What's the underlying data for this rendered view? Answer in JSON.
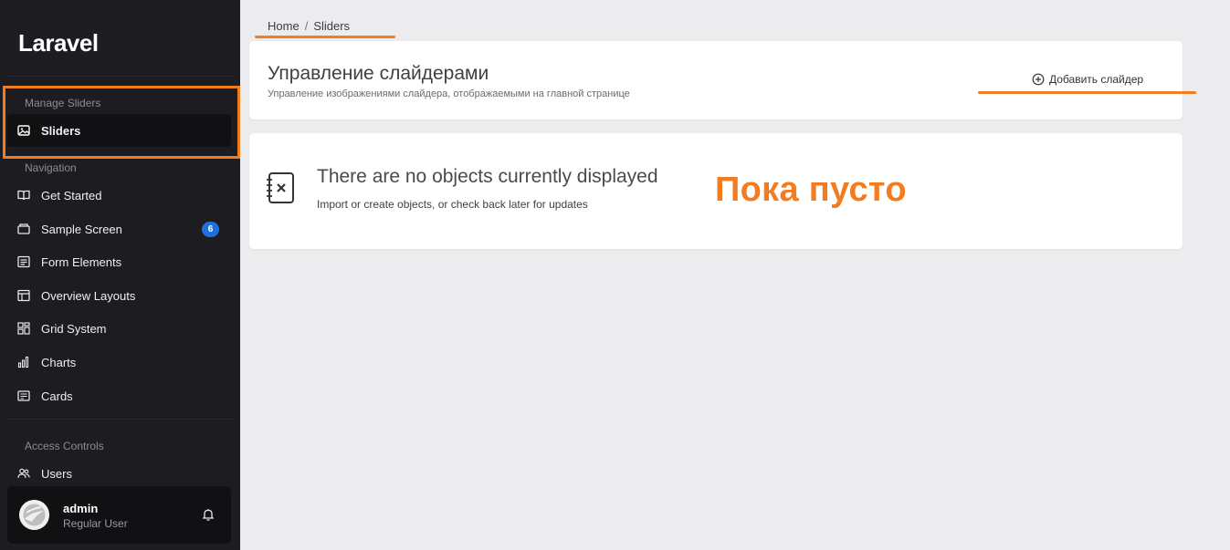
{
  "sidebar": {
    "brand": "Laravel",
    "sections": {
      "manage_sliders": "Manage Sliders",
      "navigation": "Navigation",
      "access_controls": "Access Controls"
    },
    "items": {
      "sliders": {
        "label": "Sliders",
        "icon": "image-icon"
      },
      "get_started": {
        "label": "Get Started",
        "icon": "book-icon"
      },
      "sample_screen": {
        "label": "Sample Screen",
        "icon": "inbox-icon",
        "badge": "6"
      },
      "form_elements": {
        "label": "Form Elements",
        "icon": "form-icon"
      },
      "overview_layouts": {
        "label": "Overview Layouts",
        "icon": "layout-icon"
      },
      "grid_system": {
        "label": "Grid System",
        "icon": "grid-icon"
      },
      "charts": {
        "label": "Charts",
        "icon": "bar-chart-icon"
      },
      "cards": {
        "label": "Cards",
        "icon": "card-icon"
      },
      "users": {
        "label": "Users",
        "icon": "users-icon"
      }
    },
    "user": {
      "name": "admin",
      "role": "Regular User"
    }
  },
  "breadcrumb": {
    "home": "Home",
    "separator": "/",
    "current": "Sliders"
  },
  "header": {
    "title": "Управление слайдерами",
    "subtitle": "Управление изображениями слайдера, отображаемыми на главной странице",
    "add_button": "Добавить слайдер"
  },
  "empty_state": {
    "title": "There are no objects currently displayed",
    "description": "Import or create objects, or check back later for updates"
  },
  "annotation": "Пока пусто",
  "colors": {
    "sidebar_bg": "#1c1c21",
    "accent_orange": "#f47c20",
    "badge_blue": "#1e6fe0",
    "page_bg": "#ececee"
  }
}
